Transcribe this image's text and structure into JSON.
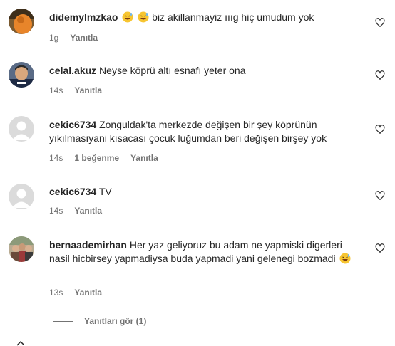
{
  "comments": [
    {
      "username": "didemylmzkao",
      "text": " biz akillanmayiz ıııg hiç umudum yok",
      "emoji_before": [
        "grinning-sweat-emoji",
        "grinning-sweat-emoji"
      ],
      "time": "1g",
      "reply_label": "Yanıtla",
      "avatar": "orange-photo-avatar"
    },
    {
      "username": "celal.akuz",
      "text": "Neyse köprü altı esnafı yeter ona",
      "time": "14s",
      "reply_label": "Yanıtla",
      "avatar": "man-photo-avatar"
    },
    {
      "username": "cekic6734",
      "text": "Zonguldak'ta merkezde değişen bir şey köprünün yıkılmasıyani kısacası çocuk luğumdan beri değişen birşey yok",
      "time": "14s",
      "likes": "1 beğenme",
      "reply_label": "Yanıtla",
      "avatar": "default-avatar"
    },
    {
      "username": "cekic6734",
      "text": "TV",
      "time": "14s",
      "reply_label": "Yanıtla",
      "avatar": "default-avatar"
    },
    {
      "username": "bernaademirhan",
      "text": "Her yaz geliyoruz bu adam ne yapmiski digerleri nasil hicbirsey yapmadiysa buda yapmadi yani gelenegi bozmadi",
      "emoji_after": "grinning-sweat-emoji",
      "time": "13s",
      "reply_label": "Yanıtla",
      "avatar": "group-photo-avatar"
    }
  ],
  "view_replies_label": "Yanıtları gör (1)",
  "colors": {
    "text": "#262626",
    "secondary": "#737373",
    "background": "#ffffff"
  }
}
